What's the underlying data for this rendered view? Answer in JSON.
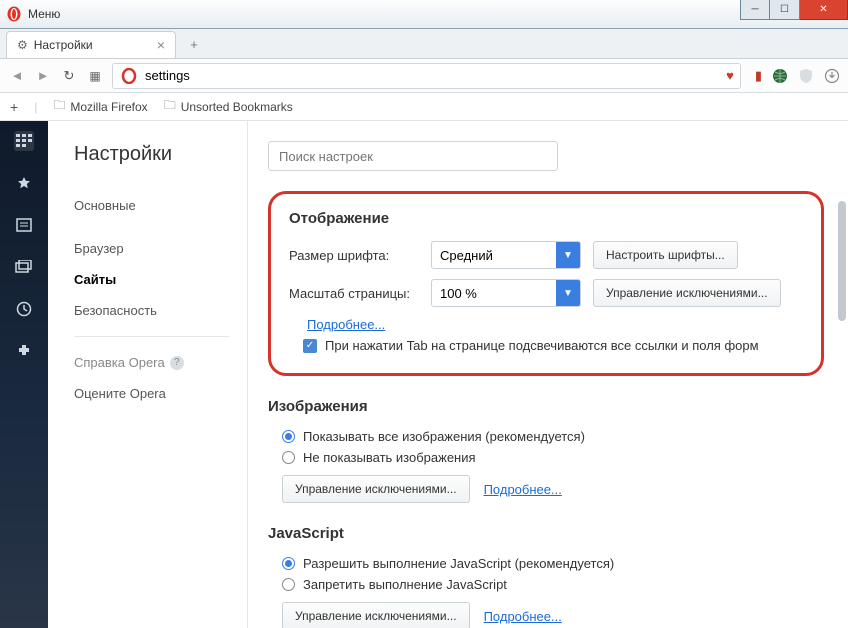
{
  "window": {
    "menu_label": "Меню"
  },
  "tab": {
    "title": "Настройки"
  },
  "address": {
    "value": "settings"
  },
  "bookmarks_bar": {
    "item1": "Mozilla Firefox",
    "item2": "Unsorted Bookmarks"
  },
  "sidebar": {
    "heading": "Настройки",
    "items": {
      "basic": "Основные",
      "browser": "Браузер",
      "sites": "Сайты",
      "security": "Безопасность"
    },
    "help": "Справка Opera",
    "rate": "Оцените Opera"
  },
  "search": {
    "placeholder": "Поиск настроек"
  },
  "display": {
    "title": "Отображение",
    "font_size_label": "Размер шрифта:",
    "font_size_value": "Средний",
    "font_button": "Настроить шрифты...",
    "zoom_label": "Масштаб страницы:",
    "zoom_value": "100 %",
    "zoom_button": "Управление исключениями...",
    "learn_more": "Подробнее...",
    "tab_highlight": "При нажатии Tab на странице подсвечиваются все ссылки и поля форм",
    "tab_highlight_checked": true
  },
  "images": {
    "title": "Изображения",
    "option_show": "Показывать все изображения (рекомендуется)",
    "option_hide": "Не показывать изображения",
    "selected": "show",
    "exceptions": "Управление исключениями...",
    "learn_more": "Подробнее..."
  },
  "javascript": {
    "title": "JavaScript",
    "option_allow": "Разрешить выполнение JavaScript (рекомендуется)",
    "option_block": "Запретить выполнение JavaScript",
    "selected": "allow",
    "exceptions": "Управление исключениями...",
    "learn_more": "Подробнее..."
  }
}
